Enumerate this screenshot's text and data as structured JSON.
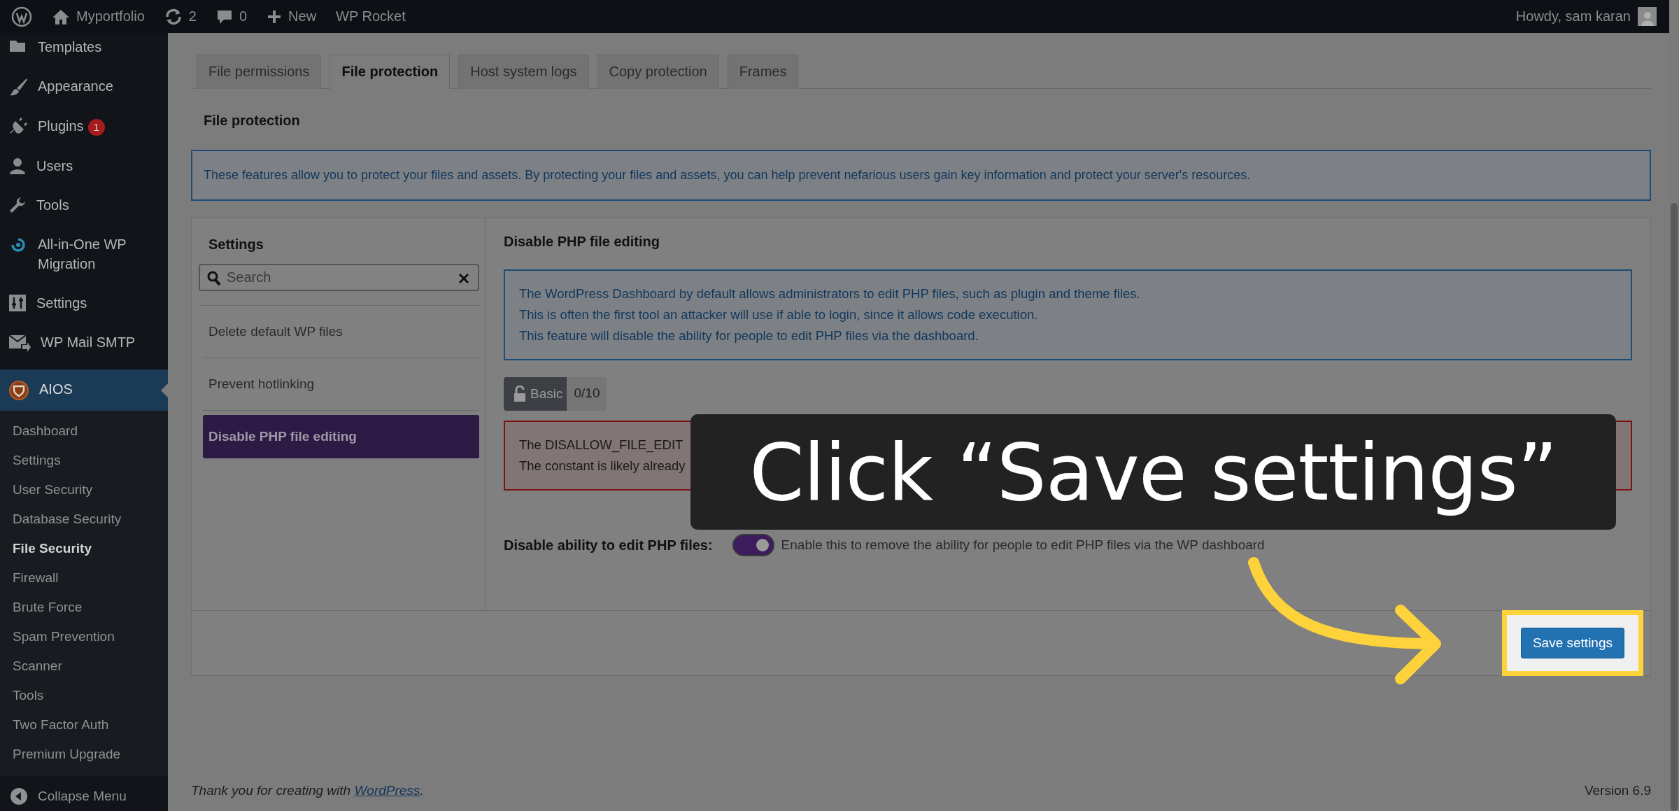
{
  "admin_bar": {
    "items": [
      {
        "kind": "logo"
      },
      {
        "kind": "home",
        "label": "Myportfolio"
      },
      {
        "kind": "updates",
        "label": "2"
      },
      {
        "kind": "comments",
        "label": "0"
      },
      {
        "kind": "new",
        "label": "New"
      },
      {
        "kind": "plain",
        "label": "WP Rocket"
      }
    ],
    "greeting": "Howdy, sam karan"
  },
  "sidebar": {
    "items": [
      {
        "kind": "templates",
        "label": "Templates",
        "selected": false
      },
      {
        "kind": "appearance",
        "label": "Appearance",
        "selected": false
      },
      {
        "kind": "plugins",
        "label": "Plugins",
        "badge": "1",
        "selected": false
      },
      {
        "kind": "users",
        "label": "Users",
        "selected": false
      },
      {
        "kind": "tools",
        "label": "Tools",
        "selected": false
      },
      {
        "kind": "migration",
        "label": "All-in-One WP Migration",
        "selected": false
      },
      {
        "kind": "settings",
        "label": "Settings",
        "selected": false
      },
      {
        "kind": "mail",
        "label": "WP Mail SMTP",
        "selected": false
      },
      {
        "kind": "shield",
        "label": "AIOS",
        "selected": true
      }
    ],
    "submenu": [
      {
        "label": "Dashboard",
        "selected": false
      },
      {
        "label": "Settings",
        "selected": false
      },
      {
        "label": "User Security",
        "selected": false
      },
      {
        "label": "Database Security",
        "selected": false
      },
      {
        "label": "File Security",
        "selected": true
      },
      {
        "label": "Firewall",
        "selected": false
      },
      {
        "label": "Brute Force",
        "selected": false
      },
      {
        "label": "Spam Prevention",
        "selected": false
      },
      {
        "label": "Scanner",
        "selected": false
      },
      {
        "label": "Tools",
        "selected": false
      },
      {
        "label": "Two Factor Auth",
        "selected": false
      },
      {
        "label": "Premium Upgrade",
        "selected": false
      }
    ],
    "collapse": "Collapse Menu"
  },
  "tabs": [
    {
      "label": "File permissions",
      "selected": false
    },
    {
      "label": "File protection",
      "selected": true
    },
    {
      "label": "Host system logs",
      "selected": false
    },
    {
      "label": "Copy protection",
      "selected": false
    },
    {
      "label": "Frames",
      "selected": false
    }
  ],
  "section_title": "File protection",
  "intro": "These features allow you to protect your files and assets. By protecting your files and assets, you can help prevent nefarious users gain key information and protect your server's resources.",
  "settings_panel": {
    "title": "Settings",
    "search": {
      "placeholder": "Search"
    },
    "items": [
      {
        "label": "Delete default WP files",
        "selected": false
      },
      {
        "label": "Prevent hotlinking",
        "selected": false
      },
      {
        "label": "Disable PHP file editing",
        "selected": true
      }
    ]
  },
  "detail": {
    "title": "Disable PHP file editing",
    "info_lines": [
      "The WordPress Dashboard by default allows administrators to edit PHP files, such as plugin and theme files.",
      "This is often the first tool an attacker will use if able to login, since it allows code execution.",
      "This feature will disable the ability for people to edit PHP files via the dashboard."
    ],
    "badge": "Basic",
    "score": "0/10",
    "error_lines": [
      "The DISALLOW_FILE_EDIT",
      "The constant is likely already"
    ],
    "option": {
      "label": "Disable ability to edit PHP files:",
      "on": true,
      "description": "Enable this to remove the ability for people to edit PHP files via the WP dashboard"
    }
  },
  "save_button": "Save settings",
  "footer": {
    "prefix": "Thank you for creating with ",
    "link": "WordPress",
    "suffix": ".",
    "version": "Version 6.9"
  },
  "callout": "Click “Save settings”"
}
